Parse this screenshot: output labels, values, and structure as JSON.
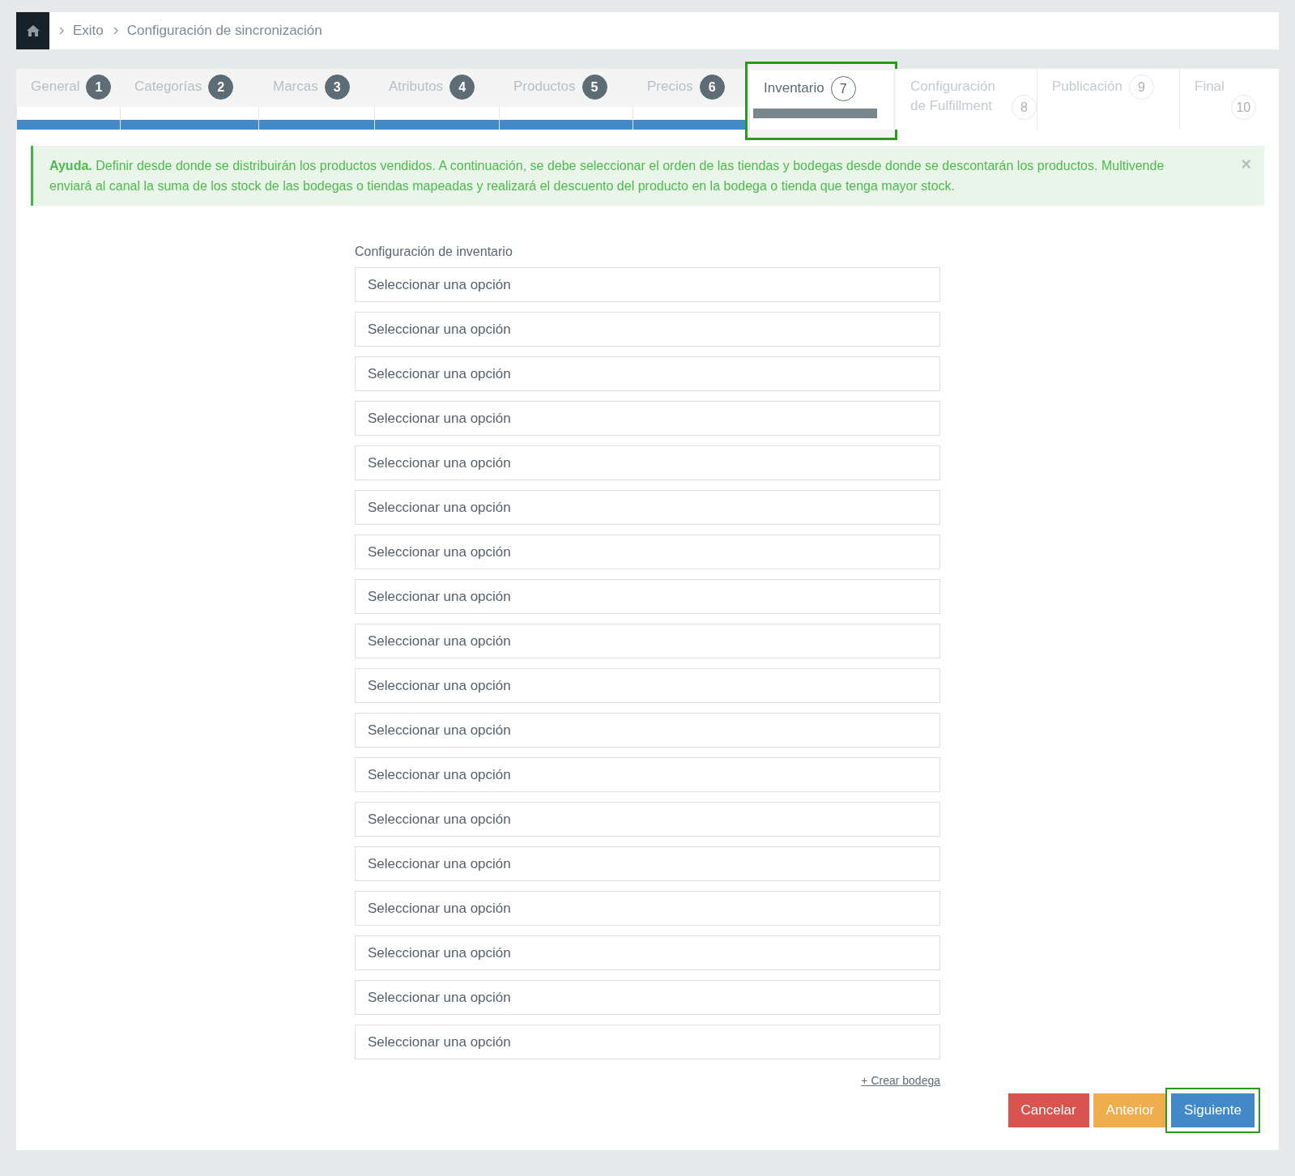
{
  "breadcrumb": [
    "Exito",
    "Configuración de sincronización"
  ],
  "steps": [
    {
      "label": "General",
      "number": "1",
      "completed": true,
      "selected": false
    },
    {
      "label": "Categorías",
      "number": "2",
      "completed": true,
      "selected": false
    },
    {
      "label": "Marcas",
      "number": "3",
      "completed": true,
      "selected": false
    },
    {
      "label": "Atributos",
      "number": "4",
      "completed": true,
      "selected": false
    },
    {
      "label": "Productos",
      "number": "5",
      "completed": true,
      "selected": false
    },
    {
      "label": "Precios",
      "number": "6",
      "completed": true,
      "selected": false
    },
    {
      "label": "Inventario",
      "number": "7",
      "completed": false,
      "selected": true
    },
    {
      "label": "Configuración de Fulfillment",
      "number": "8",
      "completed": false,
      "selected": false
    },
    {
      "label": "Publicación",
      "number": "9",
      "completed": false,
      "selected": false
    },
    {
      "label": "Final",
      "number": "10",
      "completed": false,
      "selected": false
    }
  ],
  "alert": {
    "text": "**Ayuda.** Definir desde donde se distribuirán los productos vendidos. A continuación, se debe seleccionar el orden de las tiendas y bodegas desde donde se descontarán los productos. Multivende enviará al canal la suma de los stock de las bodegas o tiendas mapeadas y realizará el descuento del producto en la bodega o tienda que tenga mayor stock.",
    "close": "×"
  },
  "form": {
    "label": "Configuración de inventario",
    "selects": [
      {
        "placeholder": "Seleccionar una opción"
      },
      {
        "placeholder": "Seleccionar una opción"
      },
      {
        "placeholder": "Seleccionar una opción"
      },
      {
        "placeholder": "Seleccionar una opción"
      },
      {
        "placeholder": "Seleccionar una opción"
      },
      {
        "placeholder": "Seleccionar una opción"
      },
      {
        "placeholder": "Seleccionar una opción"
      },
      {
        "placeholder": "Seleccionar una opción"
      },
      {
        "placeholder": "Seleccionar una opción"
      },
      {
        "placeholder": "Seleccionar una opción"
      },
      {
        "placeholder": "Seleccionar una opción"
      },
      {
        "placeholder": "Seleccionar una opción"
      },
      {
        "placeholder": "Seleccionar una opción"
      },
      {
        "placeholder": "Seleccionar una opción"
      },
      {
        "placeholder": "Seleccionar una opción"
      },
      {
        "placeholder": "Seleccionar una opción"
      },
      {
        "placeholder": "Seleccionar una opción"
      },
      {
        "placeholder": "Seleccionar una opción"
      }
    ],
    "link": "+ Crear bodega"
  },
  "buttons": [
    {
      "label": "Cancelar",
      "kind": "danger",
      "highlighted": false
    },
    {
      "label": "Anterior",
      "kind": "warning",
      "highlighted": false
    },
    {
      "label": "Siguiente",
      "kind": "primary",
      "highlighted": true
    }
  ]
}
